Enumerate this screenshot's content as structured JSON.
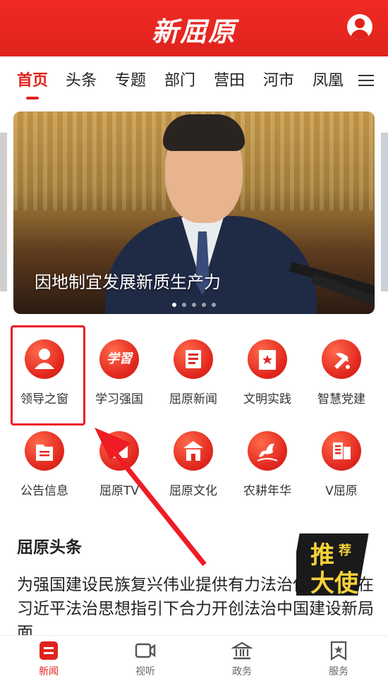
{
  "header": {
    "title": "新屈原"
  },
  "tabs": [
    {
      "label": "首页",
      "active": true
    },
    {
      "label": "头条"
    },
    {
      "label": "专题"
    },
    {
      "label": "部门"
    },
    {
      "label": "营田"
    },
    {
      "label": "河市"
    },
    {
      "label": "凤凰"
    }
  ],
  "banner": {
    "caption": "因地制宜发展新质生产力",
    "slide_count": 5,
    "active_slide": 1
  },
  "grid": [
    {
      "label": "领导之窗",
      "icon": "leader-icon"
    },
    {
      "label": "学习强国",
      "icon": "study-icon"
    },
    {
      "label": "屈原新闻",
      "icon": "news-icon"
    },
    {
      "label": "文明实践",
      "icon": "civilization-icon"
    },
    {
      "label": "智慧党建",
      "icon": "party-icon"
    },
    {
      "label": "公告信息",
      "icon": "notice-icon"
    },
    {
      "label": "屈原TV",
      "icon": "tv-icon"
    },
    {
      "label": "屈原文化",
      "icon": "culture-icon"
    },
    {
      "label": "农耕年华",
      "icon": "farming-icon"
    },
    {
      "label": "V屈原",
      "icon": "v-icon"
    }
  ],
  "news": {
    "section_title": "屈原头条",
    "headline": "为强国建设民族复兴伟业提供有力法治保障——在习近平法治思想指引下合力开创法治中国建设新局面"
  },
  "promo": {
    "text_top": "推",
    "text_mid": "荐",
    "text_bottom": "大使"
  },
  "bottom_nav": [
    {
      "label": "新闻",
      "active": true
    },
    {
      "label": "视听"
    },
    {
      "label": "政务"
    },
    {
      "label": "服务"
    }
  ],
  "colors": {
    "accent": "#e0231d",
    "highlight": "#ee1c25"
  }
}
